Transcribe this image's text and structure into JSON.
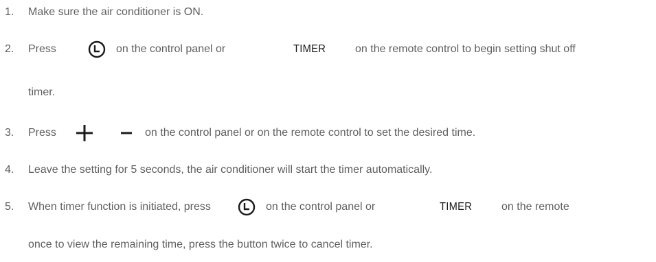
{
  "steps": [
    {
      "number": "1.",
      "text": "Make sure the air conditioner is ON."
    },
    {
      "number": "2.",
      "press": "Press",
      "mid": "on the control panel or",
      "button_word": "TIMER",
      "tail": "on the remote control to begin setting shut off",
      "continuation": "timer."
    },
    {
      "number": "3.",
      "press": "Press",
      "tail": "on the control panel or on the remote control to set the desired time."
    },
    {
      "number": "4.",
      "text": "Leave the setting for 5 seconds, the air conditioner will start the timer automatically."
    },
    {
      "number": "5.",
      "lead": "When timer function is initiated, press",
      "mid": "on the control panel or",
      "button_word": "TIMER",
      "tail": "on the remote",
      "continuation": "once to view the remaining time, press the button twice to cancel timer."
    }
  ],
  "icons": {
    "clock": "clock-icon",
    "plus": "plus-icon",
    "minus": "minus-icon"
  },
  "colors": {
    "body_text": "#5f5f5f",
    "icon": "#1a1a1a"
  }
}
